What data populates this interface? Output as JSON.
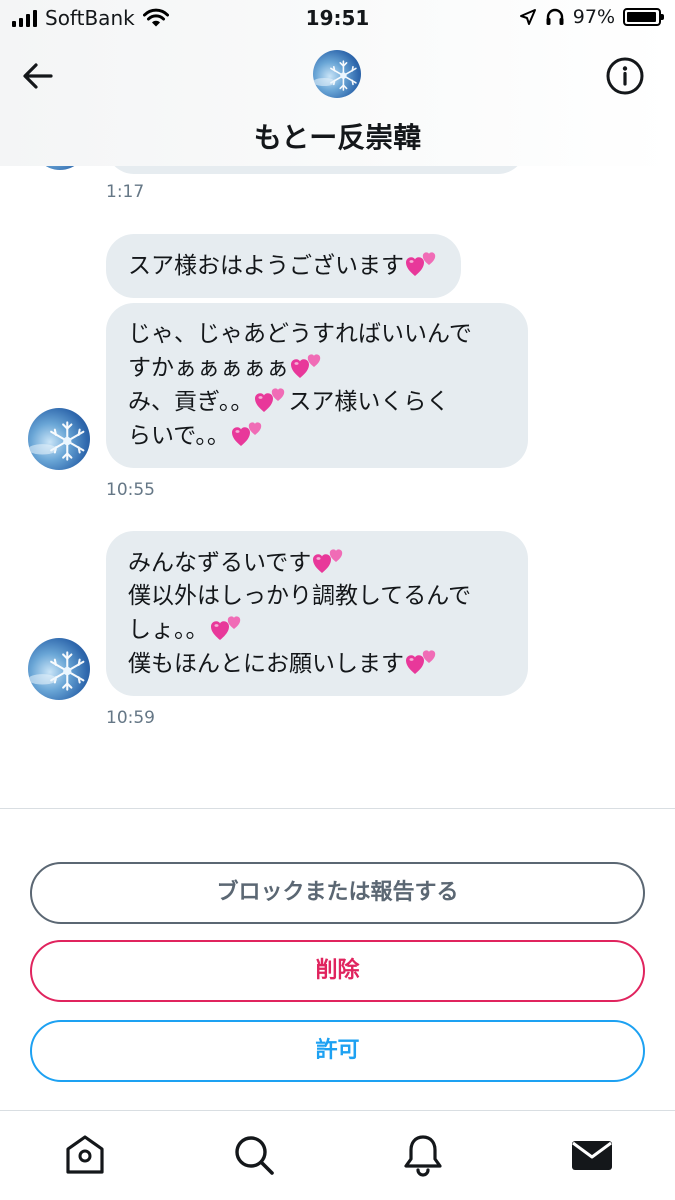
{
  "status_bar": {
    "carrier": "SoftBank",
    "time": "19:51",
    "battery_percent": "97%",
    "battery_level": 0.97
  },
  "header": {
    "title": "もとー反崇韓",
    "back_icon": "arrow-left-icon",
    "info_icon": "info-circle-icon"
  },
  "messages": {
    "timestamps": [
      "1:17",
      "10:55",
      "10:59"
    ],
    "group1": {
      "msg1": "スア様おはようございます",
      "msg2_line1": "じゃ、じゃあどうすればいいんで",
      "msg2_line2": "すかぁぁぁぁぁ",
      "msg2_line3a": "み、貢ぎ。。",
      "msg2_line3b": "スア様いくらく",
      "msg2_line4": "らいで。。"
    },
    "group2": {
      "line1": "みんなずるいです",
      "line2": "僕以外はしっかり調教してるんで",
      "line3": "しょ。。",
      "line4": "僕もほんとにお願いします"
    }
  },
  "actions": {
    "block_report": "ブロックまたは報告する",
    "delete": "削除",
    "allow": "許可"
  },
  "tab_bar": {
    "items": [
      "home-icon",
      "search-icon",
      "notifications-bell-icon",
      "messages-envelope-icon"
    ]
  },
  "colors": {
    "bubble": "#e6ecf0",
    "accent_blue": "#1da1f2",
    "danger_red": "#e0245e",
    "neutral_gray": "#5b6773",
    "heart_pink": "#e8389a"
  }
}
